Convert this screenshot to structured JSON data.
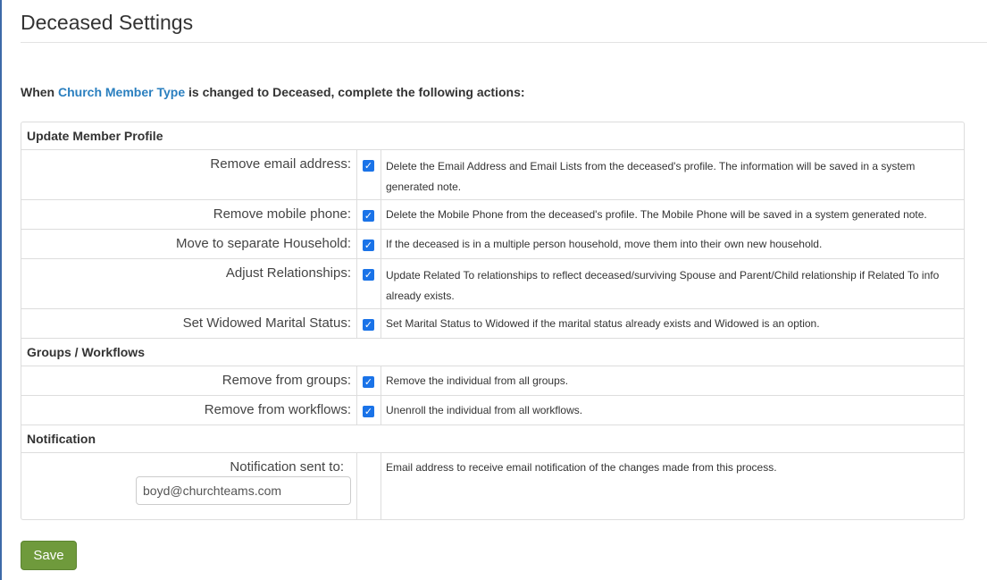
{
  "page": {
    "title": "Deceased Settings",
    "intro_prefix": "When ",
    "intro_link": "Church Member Type",
    "intro_suffix": " is changed to Deceased, complete the following actions:"
  },
  "sections": {
    "profile": {
      "heading": "Update Member Profile",
      "rows": [
        {
          "label": "Remove email address:",
          "checked": true,
          "description": "Delete the Email Address and Email Lists from the deceased's profile. The information will be saved in a system generated note."
        },
        {
          "label": "Remove mobile phone:",
          "checked": true,
          "description": "Delete the Mobile Phone from the deceased's profile. The Mobile Phone will be saved in a system generated note."
        },
        {
          "label": "Move to separate Household:",
          "checked": true,
          "description": "If the deceased is in a multiple person household, move them into their own new household."
        },
        {
          "label": "Adjust Relationships:",
          "checked": true,
          "description": "Update Related To relationships to reflect deceased/surviving Spouse and Parent/Child relationship if Related To info already exists."
        },
        {
          "label": "Set Widowed Marital Status:",
          "checked": true,
          "description": "Set Marital Status to Widowed if the marital status already exists and Widowed is an option."
        }
      ]
    },
    "groups": {
      "heading": "Groups / Workflows",
      "rows": [
        {
          "label": "Remove from groups:",
          "checked": true,
          "description": "Remove the individual from all groups."
        },
        {
          "label": "Remove from workflows:",
          "checked": true,
          "description": "Unenroll the individual from all workflows."
        }
      ]
    },
    "notification": {
      "heading": "Notification",
      "label": "Notification sent to:",
      "email_value": "boyd@churchteams.com",
      "description": "Email address to receive email notification of the changes made from this process."
    }
  },
  "actions": {
    "save_label": "Save"
  },
  "colors": {
    "link": "#2a7fbf",
    "checkbox": "#1a73e8",
    "save_button": "#6f9a3c"
  }
}
